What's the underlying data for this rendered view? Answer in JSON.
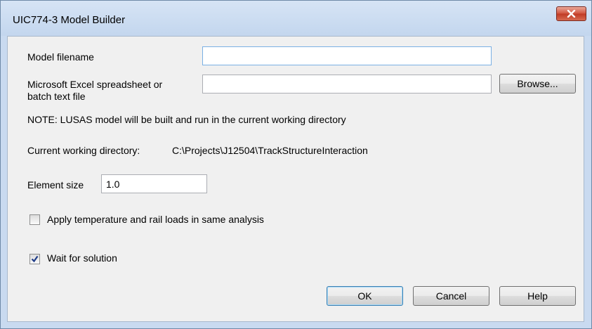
{
  "window": {
    "title": "UIC774-3 Model Builder"
  },
  "form": {
    "model_filename_label": "Model filename",
    "model_filename_value": "",
    "spreadsheet_label_line1": "Microsoft Excel spreadsheet or",
    "spreadsheet_label_line2": "batch text file",
    "spreadsheet_value": "",
    "browse_label": "Browse...",
    "note": "NOTE: LUSAS model will be built and run in the current working directory",
    "cwd_label": "Current working directory:",
    "cwd_value": "C:\\Projects\\J12504\\TrackStructureInteraction",
    "element_size_label": "Element size",
    "element_size_value": "1.0",
    "apply_temp_label": "Apply temperature and rail loads in same analysis",
    "apply_temp_checked": false,
    "wait_label": "Wait for solution",
    "wait_checked": true
  },
  "buttons": {
    "ok": "OK",
    "cancel": "Cancel",
    "help": "Help"
  },
  "colors": {
    "titlebar": "#c9daf0",
    "client": "#f0f0f0",
    "close": "#c9462c",
    "check": "#1f3c88"
  }
}
